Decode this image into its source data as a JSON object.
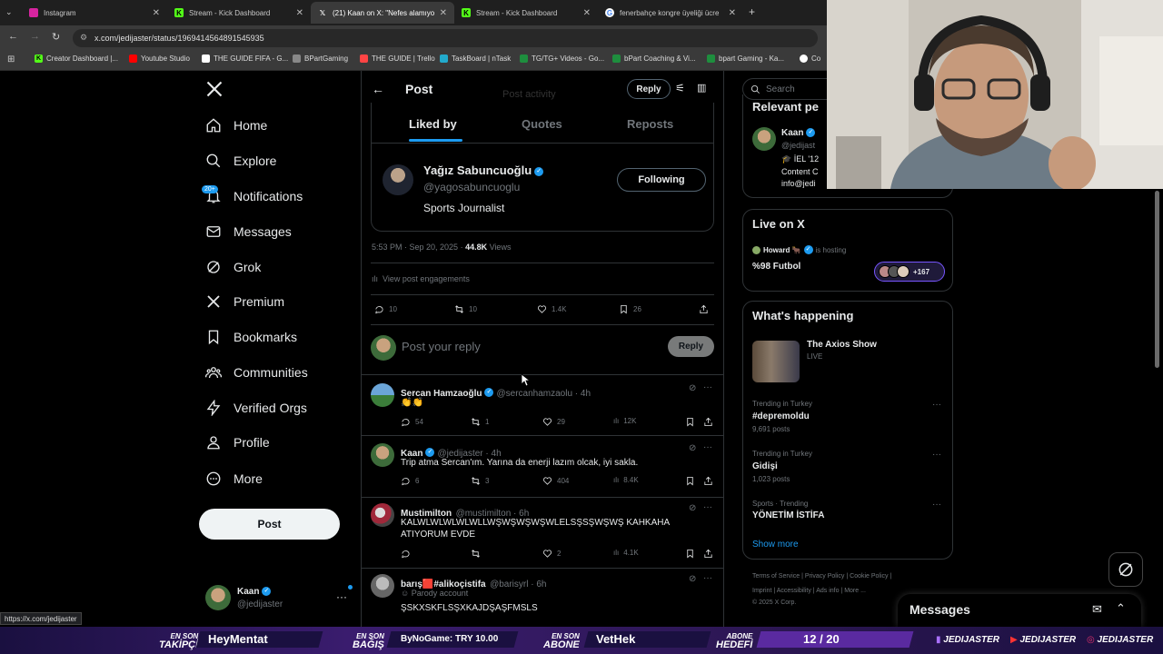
{
  "browser": {
    "tabs": [
      {
        "title": "Instagram",
        "icon": "instagram-icon"
      },
      {
        "title": "Stream - Kick Dashboard",
        "icon": "kick-icon"
      },
      {
        "title": "(21) Kaan on X: \"Nefes alamıyo",
        "icon": "x-icon"
      },
      {
        "title": "Stream - Kick Dashboard",
        "icon": "kick-icon"
      },
      {
        "title": "fenerbahçe kongre üyeliği ücre",
        "icon": "google-icon"
      }
    ],
    "url": "x.com/jedijaster/status/1969414564891545935",
    "bookmarks": [
      "Creator Dashboard |...",
      "Youtube Studio",
      "THE GUIDE FIFA - G...",
      "BPartGaming",
      "THE GUIDE | Trello",
      "TaskBoard | nTask",
      "TG/TG+ Videos - Go...",
      "bPart Coaching & Vi...",
      "bpart Gaming - Ka...",
      "Co"
    ]
  },
  "nav": {
    "items": [
      "Home",
      "Explore",
      "Notifications",
      "Messages",
      "Grok",
      "Premium",
      "Bookmarks",
      "Communities",
      "Verified Orgs",
      "Profile",
      "More"
    ],
    "notif_badge": "20+",
    "post_button": "Post",
    "account": {
      "name": "Kaan",
      "handle": "@jedijaster"
    }
  },
  "header": {
    "title": "Post",
    "reply_button": "Reply",
    "faded_text": "Post activity"
  },
  "tabs": [
    "Liked by",
    "Quotes",
    "Reposts"
  ],
  "liker": {
    "name": "Yağız Sabuncuoğlu",
    "handle": "@yagosabuncuoglu",
    "bio": "Sports Journalist",
    "follow_button": "Following"
  },
  "post_meta": {
    "time": "5:53 PM · Sep 20, 2025 · ",
    "views_count": "44.8K",
    "views_label": " Views",
    "engagements": "View post engagements",
    "replies": "10",
    "reposts": "10",
    "likes": "1.4K",
    "bookmarks": "26"
  },
  "composer": {
    "placeholder": "Post your reply",
    "button": "Reply"
  },
  "replies": [
    {
      "name": "Sercan Hamzaoğlu",
      "handle": "@sercanhamzaolu · 4h",
      "text": "👏👏",
      "replies": "54",
      "reposts": "1",
      "likes": "29",
      "views": "12K"
    },
    {
      "name": "Kaan",
      "handle": "@jedijaster · 4h",
      "text": "Trip atma Sercan'ım. Yarına da enerji lazım olcak, iyi sakla.",
      "replies": "6",
      "reposts": "3",
      "likes": "404",
      "views": "8.4K"
    },
    {
      "name": "Mustimilton",
      "handle": "@mustimilton · 6h",
      "text": "KALWLWLWLWLWLLWŞWŞWŞWŞWLELSŞSŞWŞWŞ KAHKAHA ATIYORUM EVDE",
      "replies": "",
      "reposts": "",
      "likes": "2",
      "views": "4.1K"
    },
    {
      "name": "barış🟥#alikoçistifa",
      "handle": "@barisyrl · 6h",
      "parody": "Parody account",
      "text": "ŞSKXSKFLSŞXKAJDŞAŞFMSLS"
    }
  ],
  "right": {
    "search_placeholder": "Search",
    "relevant": {
      "title": "Relevant pe",
      "name": "Kaan",
      "handle": "@jedijast",
      "bio_line1": "🎓 İEL '12",
      "bio_line2": "Content C",
      "bio_line3": "info@jedi"
    },
    "live": {
      "title": "Live on X",
      "host": "Howard 🐂",
      "hosting": "is hosting",
      "space": "%98 Futbol",
      "count": "+167"
    },
    "happening": {
      "title": "What's happening",
      "show": {
        "name": "The Axios Show",
        "status": "LIVE"
      },
      "trends": [
        {
          "context": "Trending in Turkey",
          "topic": "#depremoldu",
          "count": "9,691 posts"
        },
        {
          "context": "Trending in Turkey",
          "topic": "Gidişi",
          "count": "1,023 posts"
        },
        {
          "context": "Sports · Trending",
          "topic": "YÖNETİM İSTİFA",
          "count": ""
        }
      ],
      "show_more": "Show more"
    },
    "footer": {
      "row1": [
        "Terms of Service",
        "Privacy Policy",
        "Cookie Policy"
      ],
      "row2": [
        "Imprint",
        "Accessibility",
        "Ads info",
        "More ..."
      ],
      "copyright": "© 2025 X Corp."
    },
    "messages_dock": "Messages"
  },
  "status_url": "https://x.com/jedijaster",
  "overlay": {
    "follower_label1": "EN SON",
    "follower_label2": "TAKİPÇİ",
    "follower_value": "HeyMentat",
    "donation_label1": "EN SON",
    "donation_label2": "BAĞIŞ",
    "donation_value": "ByNoGame: TRY 10.00",
    "sub_label1": "EN SON",
    "sub_label2": "ABONE",
    "sub_value": "VetHek",
    "goal_label1": "ABONE",
    "goal_label2": "HEDEFİ",
    "goal_value": "12 / 20",
    "handles": [
      "JEDIJASTER",
      "JEDIJASTER",
      "JEDIJASTER"
    ]
  },
  "colors": {
    "accent": "#1d9bf0",
    "bg": "#000000",
    "border": "#2f3336",
    "overlay_bar": "#2a1650"
  }
}
